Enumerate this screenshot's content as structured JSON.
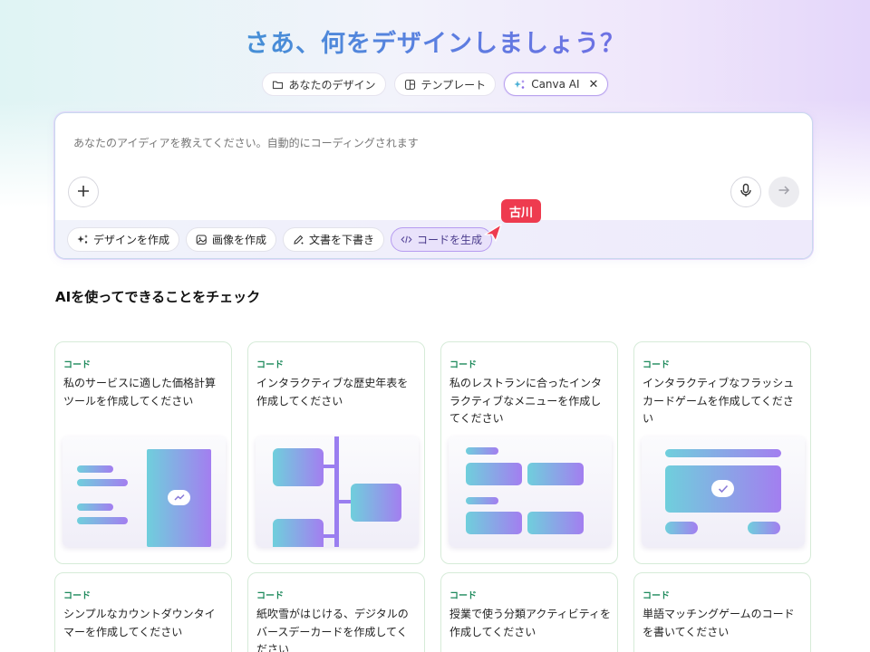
{
  "hero": {
    "title": "さあ、何をデザインしましょう？"
  },
  "mode_tabs": [
    {
      "label": "あなたのデザイン",
      "icon": "folder-icon"
    },
    {
      "label": "テンプレート",
      "icon": "template-icon"
    },
    {
      "label": "Canva AI",
      "icon": "sparkle-icon",
      "active": true
    }
  ],
  "prompt": {
    "placeholder": "あなたのアイディアを教えてください。自動的にコーディングされます",
    "plus_icon": "plus-icon",
    "mic_icon": "microphone-icon",
    "send_icon": "arrow-right-icon"
  },
  "chips": [
    {
      "label": "デザインを作成",
      "icon": "sparkle-icon"
    },
    {
      "label": "画像を作成",
      "icon": "image-sparkle-icon"
    },
    {
      "label": "文書を下書き",
      "icon": "pen-icon"
    },
    {
      "label": "コードを生成",
      "icon": "code-icon",
      "active": true
    }
  ],
  "cursor": {
    "name": "古川",
    "color": "#ee3b4f"
  },
  "section": {
    "title": "AIを使ってできることをチェック"
  },
  "cards": [
    {
      "tag": "コード",
      "desc": "私のサービスに適した価格計算ツールを作成してください"
    },
    {
      "tag": "コード",
      "desc": "インタラクティブな歴史年表を作成してください"
    },
    {
      "tag": "コード",
      "desc": "私のレストランに合ったインタラクティブなメニューを作成してください"
    },
    {
      "tag": "コード",
      "desc": "インタラクティブなフラッシュカードゲームを作成してください"
    },
    {
      "tag": "コード",
      "desc": "シンプルなカウントダウンタイマーを作成してください"
    },
    {
      "tag": "コード",
      "desc": "紙吹雪がはじける、デジタルのバースデーカードを作成してください"
    },
    {
      "tag": "コード",
      "desc": "授業で使う分類アクティビティを作成してください"
    },
    {
      "tag": "コード",
      "desc": "単語マッチングゲームのコードを書いてください"
    }
  ],
  "colors": {
    "accent_teal": "#6fcfdc",
    "accent_purple": "#a37ef0",
    "tag_green": "#1e8a5c"
  }
}
